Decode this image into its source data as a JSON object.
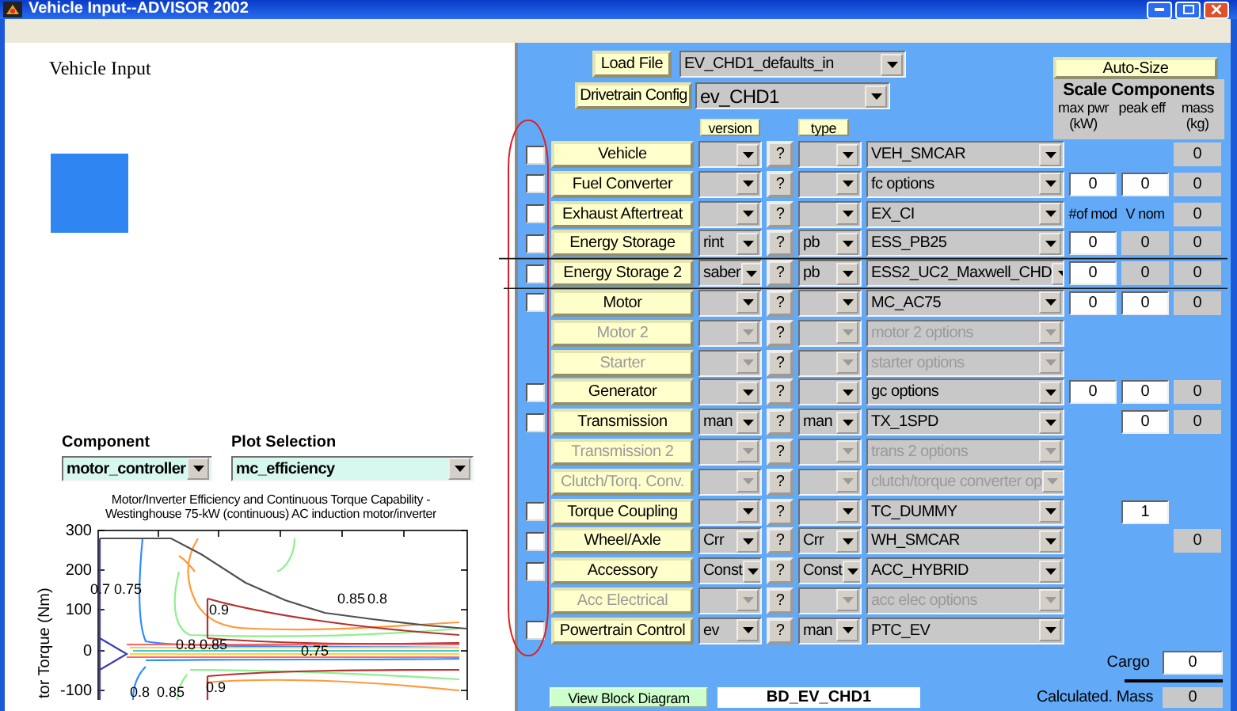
{
  "window": {
    "title": "Vehicle Input--ADVISOR 2002"
  },
  "left": {
    "heading": "Vehicle Input",
    "component": {
      "label": "Component",
      "value": "motor_controller"
    },
    "plot_selection": {
      "label": "Plot Selection",
      "value": "mc_efficiency"
    },
    "plot": {
      "title_lines": [
        "Motor/Inverter Efficiency and Continuous Torque Capability -",
        "Westinghouse 75-kW (continuous) AC induction motor/inverter"
      ],
      "y_axis_label": "tor Torque (Nm)",
      "y_ticks": [
        "300",
        "200",
        "100",
        "0",
        "-100"
      ],
      "contour_labels": [
        "0.7",
        "0.75",
        "0.9",
        "0.8",
        "0.85",
        "0.85",
        "0.8",
        "0.75",
        "0.8",
        "0.85",
        "0.9"
      ]
    }
  },
  "toolbar": {
    "load_file": {
      "button": "Load File",
      "value": "EV_CHD1_defaults_in"
    },
    "drivetrain_config": {
      "button": "Drivetrain Config",
      "value": "ev_CHD1"
    },
    "version_button": "version",
    "type_button": "type",
    "auto_size_button": "Auto-Size"
  },
  "scale_components": {
    "title": "Scale Components",
    "columns": [
      "max pwr (kW)",
      "peak eff",
      "mass (kg)"
    ]
  },
  "components": [
    {
      "name": "Vehicle",
      "disabled": false,
      "checked": false,
      "help": "?",
      "option": "VEH_SMCAR",
      "scale": {
        "mass": {
          "kind": "readout",
          "value": "0"
        }
      }
    },
    {
      "name": "Fuel Converter",
      "disabled": false,
      "checked": false,
      "help": "?",
      "option": "fc options",
      "scale": {
        "max_pwr": {
          "kind": "input",
          "value": "0"
        },
        "peak_eff": {
          "kind": "input",
          "value": "0"
        },
        "mass": {
          "kind": "readout",
          "value": "0"
        }
      }
    },
    {
      "name": "Exhaust Aftertreat",
      "disabled": false,
      "checked": false,
      "help": "?",
      "option": "EX_CI",
      "scale": {
        "max_pwr": {
          "kind": "label",
          "value": "#of mod"
        },
        "peak_eff": {
          "kind": "label",
          "value": "V nom"
        },
        "mass": {
          "kind": "readout",
          "value": "0"
        }
      }
    },
    {
      "name": "Energy Storage",
      "disabled": false,
      "checked": false,
      "version": "rint",
      "help": "?",
      "type": "pb",
      "option": "ESS_PB25",
      "scale": {
        "max_pwr": {
          "kind": "input",
          "value": "0"
        },
        "peak_eff": {
          "kind": "readout",
          "value": "0"
        },
        "mass": {
          "kind": "readout",
          "value": "0"
        }
      }
    },
    {
      "name": "Energy Storage 2",
      "disabled": false,
      "checked": false,
      "version": "saber",
      "help": "?",
      "type": "pb",
      "option": "ESS2_UC2_Maxwell_CHD",
      "scale": {
        "max_pwr": {
          "kind": "input",
          "value": "0"
        },
        "peak_eff": {
          "kind": "readout",
          "value": "0"
        },
        "mass": {
          "kind": "readout",
          "value": "0"
        }
      }
    },
    {
      "name": "Motor",
      "disabled": false,
      "checked": false,
      "help": "?",
      "option": "MC_AC75",
      "scale": {
        "max_pwr": {
          "kind": "input",
          "value": "0"
        },
        "peak_eff": {
          "kind": "input",
          "value": "0"
        },
        "mass": {
          "kind": "readout",
          "value": "0"
        }
      }
    },
    {
      "name": "Motor 2",
      "disabled": true,
      "help": "?",
      "option": "motor 2 options"
    },
    {
      "name": "Starter",
      "disabled": true,
      "help": "?",
      "option": "starter options"
    },
    {
      "name": "Generator",
      "disabled": false,
      "checked": false,
      "help": "?",
      "option": "gc options",
      "scale": {
        "max_pwr": {
          "kind": "input",
          "value": "0"
        },
        "peak_eff": {
          "kind": "input",
          "value": "0"
        },
        "mass": {
          "kind": "readout",
          "value": "0"
        }
      }
    },
    {
      "name": "Transmission",
      "disabled": false,
      "checked": false,
      "version": "man",
      "help": "?",
      "type": "man",
      "option": "TX_1SPD",
      "scale": {
        "peak_eff": {
          "kind": "input",
          "value": "0"
        },
        "mass": {
          "kind": "readout",
          "value": "0"
        }
      }
    },
    {
      "name": "Transmission 2",
      "disabled": true,
      "help": "?",
      "option": "trans 2 options"
    },
    {
      "name": "Clutch/Torq. Conv.",
      "disabled": true,
      "help": "?",
      "option": "clutch/torque converter op"
    },
    {
      "name": "Torque Coupling",
      "disabled": false,
      "checked": false,
      "help": "?",
      "option": "TC_DUMMY",
      "scale": {
        "peak_eff": {
          "kind": "input",
          "value": "1"
        }
      }
    },
    {
      "name": "Wheel/Axle",
      "disabled": false,
      "checked": false,
      "version": "Crr",
      "help": "?",
      "type": "Crr",
      "option": "WH_SMCAR",
      "scale": {
        "mass": {
          "kind": "readout",
          "value": "0"
        }
      }
    },
    {
      "name": "Accessory",
      "disabled": false,
      "checked": false,
      "version": "Const",
      "help": "?",
      "type": "Const",
      "option": "ACC_HYBRID"
    },
    {
      "name": "Acc Electrical",
      "disabled": true,
      "help": "?",
      "option": "acc elec options"
    },
    {
      "name": "Powertrain Control",
      "disabled": false,
      "checked": false,
      "version": "ev",
      "help": "?",
      "type": "man",
      "option": "PTC_EV"
    }
  ],
  "cargo": {
    "label": "Cargo",
    "value": "0"
  },
  "calculated_mass": {
    "label": "Calculated. Mass",
    "value": "0"
  },
  "block_diagram": {
    "button": "View Block Diagram",
    "value": "BD_EV_CHD1"
  }
}
